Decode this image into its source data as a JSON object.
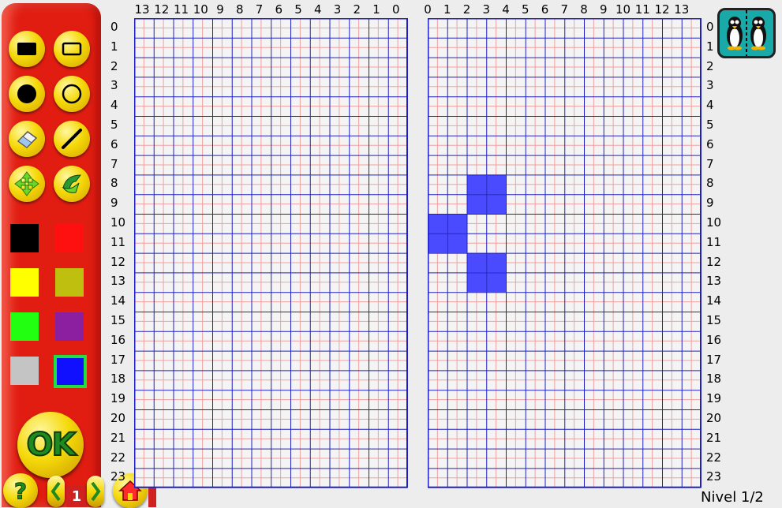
{
  "toolbar": {
    "tools": [
      {
        "name": "filled-rectangle-tool",
        "icon": "filled-rectangle-icon"
      },
      {
        "name": "outline-rectangle-tool",
        "icon": "outline-rectangle-icon"
      },
      {
        "name": "filled-circle-tool",
        "icon": "filled-circle-icon"
      },
      {
        "name": "outline-circle-tool",
        "icon": "outline-circle-icon"
      },
      {
        "name": "eraser-tool",
        "icon": "eraser-icon"
      },
      {
        "name": "line-tool",
        "icon": "line-icon"
      },
      {
        "name": "move-tool",
        "icon": "move-arrows-icon"
      },
      {
        "name": "flip-tool",
        "icon": "flip-icon"
      }
    ],
    "colors": [
      {
        "name": "black",
        "hex": "#000000"
      },
      {
        "name": "red",
        "hex": "#ff1010"
      },
      {
        "name": "yellow",
        "hex": "#ffff00"
      },
      {
        "name": "olive",
        "hex": "#bfbf10"
      },
      {
        "name": "green",
        "hex": "#22ff10"
      },
      {
        "name": "purple",
        "hex": "#8b1fa0"
      },
      {
        "name": "gray",
        "hex": "#c4c4c4"
      },
      {
        "name": "blue",
        "hex": "#1010ff"
      }
    ],
    "selected_color": "blue",
    "ok_label": "OK"
  },
  "nav": {
    "help_icon": "question-mark-icon",
    "prev_icon": "left-chevron-icon",
    "level_number": "1",
    "next_icon": "right-chevron-icon",
    "home_icon": "home-icon"
  },
  "left_grid": {
    "col_labels": [
      "13",
      "12",
      "11",
      "10",
      "9",
      "8",
      "7",
      "6",
      "5",
      "4",
      "3",
      "2",
      "1",
      "0"
    ],
    "row_labels": [
      "0",
      "1",
      "2",
      "3",
      "4",
      "5",
      "6",
      "7",
      "8",
      "9",
      "10",
      "11",
      "12",
      "13",
      "14",
      "15",
      "16",
      "17",
      "18",
      "19",
      "20",
      "21",
      "22",
      "23"
    ],
    "filled_cells": []
  },
  "right_grid": {
    "col_labels": [
      "0",
      "1",
      "2",
      "3",
      "4",
      "5",
      "6",
      "7",
      "8",
      "9",
      "10",
      "11",
      "12",
      "13"
    ],
    "row_labels": [
      "0",
      "1",
      "2",
      "3",
      "4",
      "5",
      "6",
      "7",
      "8",
      "9",
      "10",
      "11",
      "12",
      "13",
      "14",
      "15",
      "16",
      "17",
      "18",
      "19",
      "20",
      "21",
      "22",
      "23"
    ],
    "filled_cells": [
      [
        2,
        8
      ],
      [
        3,
        8
      ],
      [
        2,
        9
      ],
      [
        3,
        9
      ],
      [
        0,
        10
      ],
      [
        1,
        10
      ],
      [
        0,
        11
      ],
      [
        1,
        11
      ],
      [
        2,
        12
      ],
      [
        3,
        12
      ],
      [
        2,
        13
      ],
      [
        3,
        13
      ]
    ],
    "fill_color": "#4a4aff"
  },
  "grid_colors": {
    "major": "#2020c0",
    "minor": "#f0a0a0"
  },
  "mirror_button_icon": "penguins-mirror-icon",
  "status": "Nivel 1/2"
}
